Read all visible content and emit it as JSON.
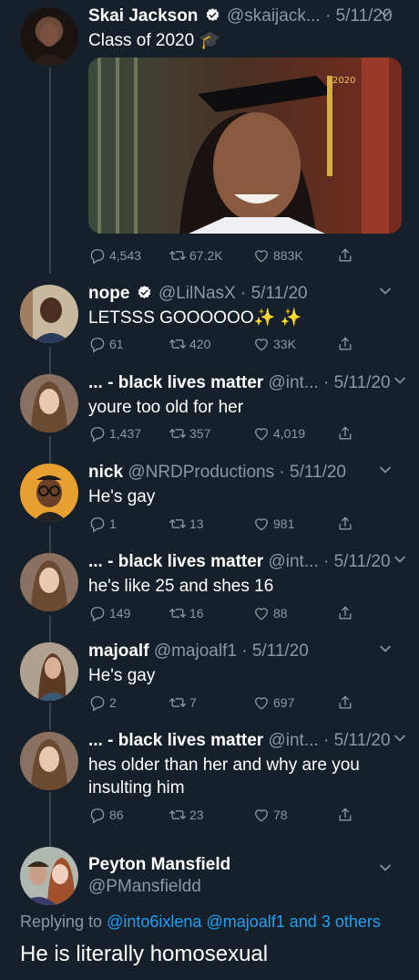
{
  "tweets": [
    {
      "name": "Skai Jackson",
      "verified": true,
      "handle": "@skaijack...",
      "date": "5/11/20",
      "text": "Class of 2020 🎓",
      "media_caption": "2020",
      "replies": "4,543",
      "retweets": "67.2K",
      "likes": "883K"
    },
    {
      "name": "nope",
      "verified": true,
      "handle": "@LilNasX",
      "date": "5/11/20",
      "text": "LETSSS GOOOOOO✨ ✨",
      "replies": "61",
      "retweets": "420",
      "likes": "33K"
    },
    {
      "name": "... - black lives matter",
      "handle": "@int...",
      "date": "5/11/20",
      "text": "youre too old for her",
      "replies": "1,437",
      "retweets": "357",
      "likes": "4,019"
    },
    {
      "name": "nick",
      "handle": "@NRDProductions",
      "date": "5/11/20",
      "text": "He's gay",
      "replies": "1",
      "retweets": "13",
      "likes": "981"
    },
    {
      "name": "... - black lives matter",
      "handle": "@int...",
      "date": "5/11/20",
      "text": "he's like 25 and shes 16",
      "replies": "149",
      "retweets": "16",
      "likes": "88"
    },
    {
      "name": "majoalf",
      "handle": "@majoalf1",
      "date": "5/11/20",
      "text": "He's gay",
      "replies": "2",
      "retweets": "7",
      "likes": "697"
    },
    {
      "name": "... - black lives matter",
      "handle": "@int...",
      "date": "5/11/20",
      "text": "hes older than her and why are you insulting him",
      "replies": "86",
      "retweets": "23",
      "likes": "78"
    }
  ],
  "final": {
    "name": "Peyton Mansfield",
    "handle": "@PMansfieldd",
    "replying_prefix": "Replying to",
    "mention1": "@into6ixlena",
    "mention2": "@majoalf1",
    "and_text": "and",
    "others": "3 others",
    "text": "He is literally homosexual"
  },
  "separator": "·",
  "colors": {
    "background": "#15202b",
    "secondary_text": "#8899a6",
    "accent": "#1da1f2",
    "thread_line": "#38444d"
  }
}
